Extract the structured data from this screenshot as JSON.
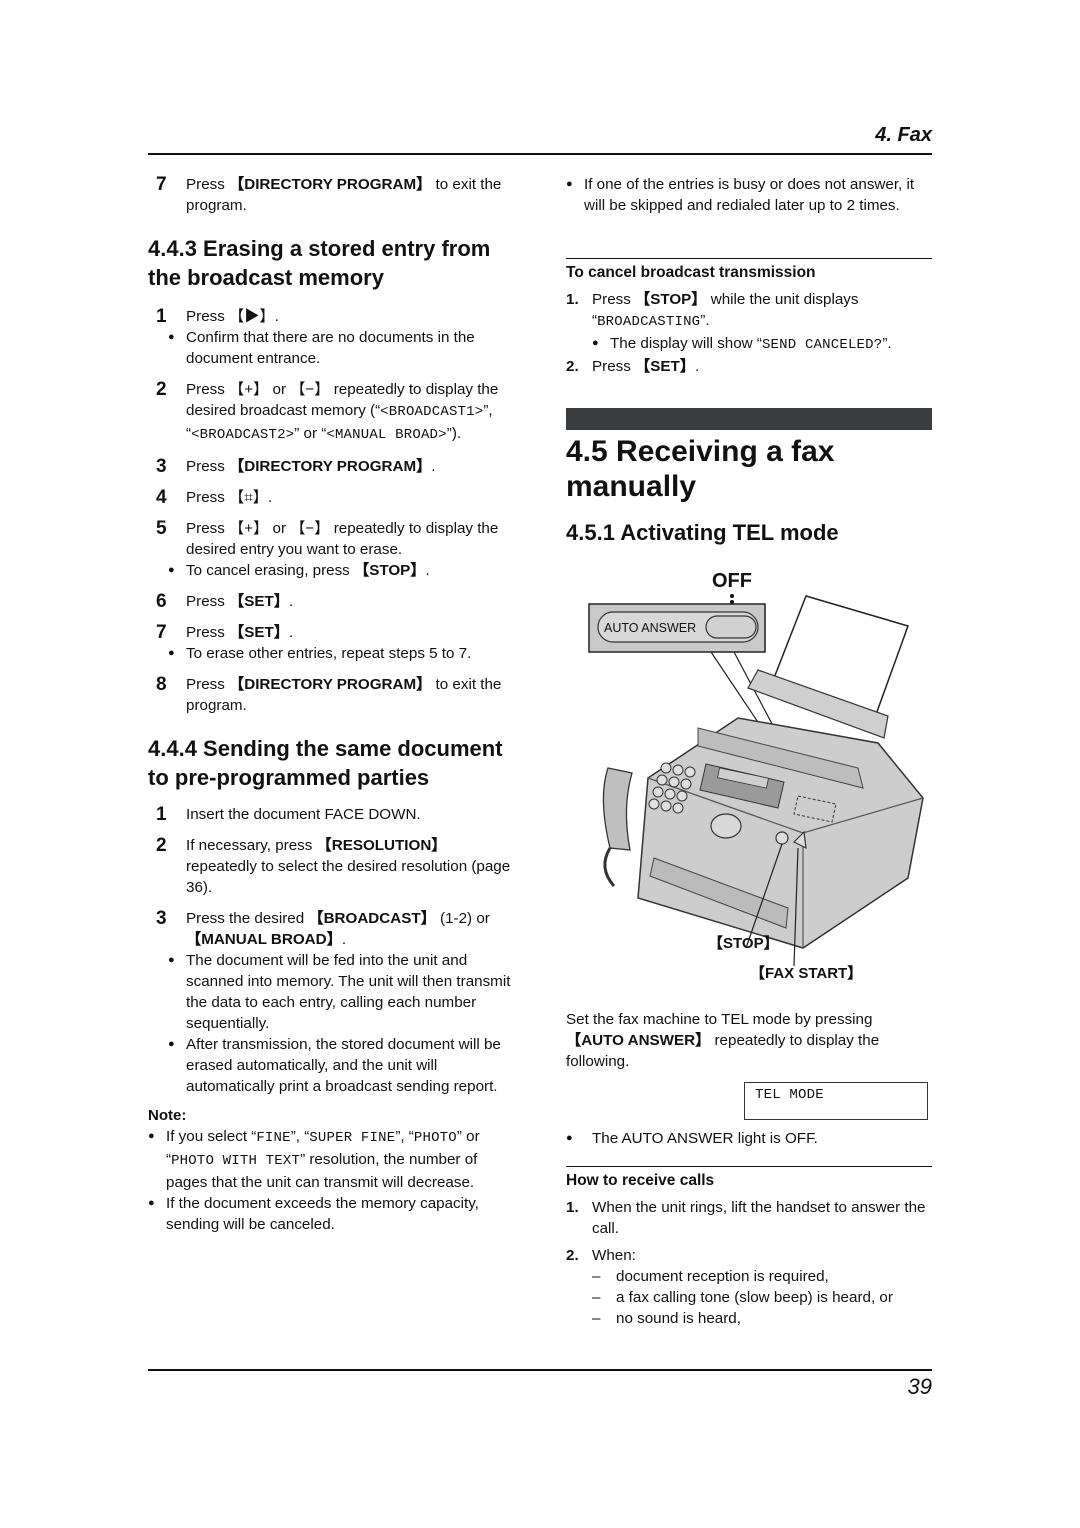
{
  "header": {
    "chapter": "4. Fax"
  },
  "left": {
    "step7_prev": {
      "num": "7",
      "pre": "Press ",
      "key": "【DIRECTORY PROGRAM】",
      "post": " to exit the program."
    },
    "sec443": {
      "title": "4.4.3 Erasing a stored entry from the broadcast memory",
      "steps": [
        {
          "num": "1",
          "text": "Press 【▶】.",
          "bullets": [
            "Confirm that there are no documents in the document entrance."
          ]
        },
        {
          "num": "2",
          "pre": "Press 【+】 or 【−】 repeatedly to display the desired broadcast memory (“",
          "m1": "<BROADCAST1>",
          "mid1": "”, “",
          "m2": "<BROADCAST2>",
          "mid2": "” or “",
          "m3": "<MANUAL BROAD>",
          "post": "”)."
        },
        {
          "num": "3",
          "pre": "Press ",
          "key": "【DIRECTORY PROGRAM】",
          "post": "."
        },
        {
          "num": "4",
          "text": "Press 【⌗】."
        },
        {
          "num": "5",
          "text": "Press 【+】 or 【−】 repeatedly to display the desired entry you want to erase.",
          "bullet_pre": "To cancel erasing, press ",
          "bullet_key": "【STOP】",
          "bullet_post": "."
        },
        {
          "num": "6",
          "pre": "Press ",
          "key": "【SET】",
          "post": "."
        },
        {
          "num": "7",
          "pre": "Press ",
          "key": "【SET】",
          "post": ".",
          "bullets": [
            "To erase other entries, repeat steps 5 to 7."
          ]
        },
        {
          "num": "8",
          "pre": "Press ",
          "key": "【DIRECTORY PROGRAM】",
          "post": " to exit the program."
        }
      ]
    },
    "sec444": {
      "title": "4.4.4 Sending the same document to pre-programmed parties",
      "steps": [
        {
          "num": "1",
          "text": "Insert the document FACE DOWN."
        },
        {
          "num": "2",
          "pre": "If necessary, press ",
          "key": "【RESOLUTION】",
          "post": " repeatedly to select the desired resolution (page 36)."
        },
        {
          "num": "3",
          "pre": "Press the desired ",
          "key": "【BROADCAST】",
          "mid": " (1-2) or ",
          "key2": "【MANUAL BROAD】",
          "post": ".",
          "bullets": [
            "The document will be fed into the unit and scanned into memory. The unit will then transmit the data to each entry, calling each number sequentially.",
            "After transmission, the stored document will be erased automatically, and the unit will automatically print a broadcast sending report."
          ]
        }
      ],
      "note_label": "Note:",
      "notes": {
        "n1_pre": "If you select “",
        "n1_m1": "FINE",
        "n1_a": "”, “",
        "n1_m2": "SUPER FINE",
        "n1_b": "”, “",
        "n1_m3": "PHOTO",
        "n1_c": "” or “",
        "n1_m4": "PHOTO WITH TEXT",
        "n1_post": "” resolution, the number of pages that the unit can transmit will decrease.",
        "n2": "If the document exceeds the memory capacity, sending will be canceled."
      }
    }
  },
  "right": {
    "top_bullet": "If one of the entries is busy or does not answer, it will be skipped and redialed later up to 2 times.",
    "cancel": {
      "title": "To cancel broadcast transmission",
      "s1_num": "1.",
      "s1_pre": "Press ",
      "s1_key": "【STOP】",
      "s1_post": " while the unit displays “",
      "s1_mono": "BROADCASTING",
      "s1_end": "”.",
      "s1_bullet_pre": "The display will show “",
      "s1_bullet_mono": "SEND CANCELED?",
      "s1_bullet_post": "”.",
      "s2_num": "2.",
      "s2_pre": "Press ",
      "s2_key": "【SET】",
      "s2_post": "."
    },
    "sec45": {
      "title": "4.5 Receiving a fax manually"
    },
    "sec451": {
      "title": "4.5.1 Activating TEL mode"
    },
    "figure": {
      "off_label": "OFF",
      "auto_answer_label": "AUTO ANSWER",
      "stop_label": "【STOP】",
      "fax_start_label": "【FAX START】"
    },
    "set_text_pre": "Set the fax machine to TEL mode by pressing ",
    "set_text_key": "【AUTO ANSWER】",
    "set_text_post": " repeatedly to display the following.",
    "lcd_text": "TEL MODE",
    "light_bullet": "The AUTO ANSWER light is OFF.",
    "receive": {
      "title": "How to receive calls",
      "s1_num": "1.",
      "s1": "When the unit rings, lift the handset to answer the call.",
      "s2_num": "2.",
      "s2": "When:",
      "dashes": [
        "document reception is required,",
        "a fax calling tone (slow beep) is heard, or",
        "no sound is heard,"
      ]
    }
  },
  "footer": {
    "page_number": "39"
  }
}
